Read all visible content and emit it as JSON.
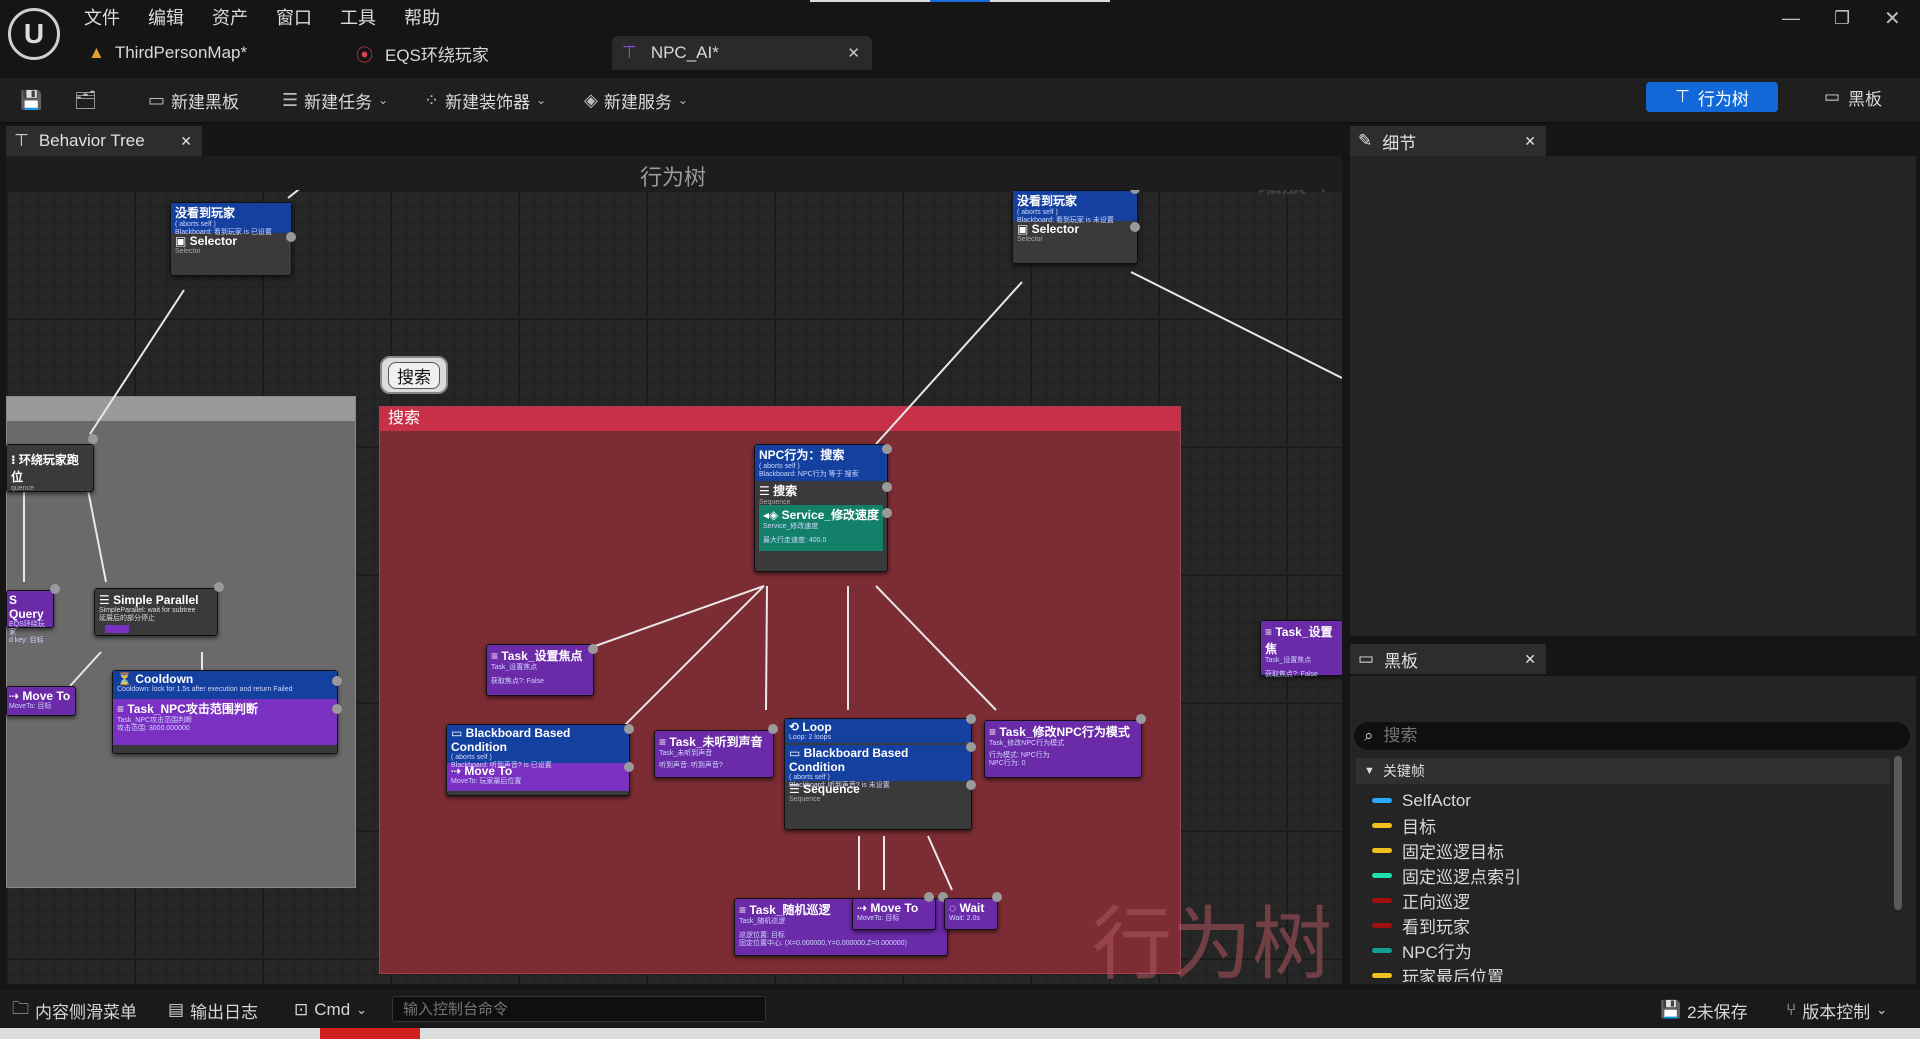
{
  "menu": {
    "items": [
      "文件",
      "编辑",
      "资产",
      "窗口",
      "工具",
      "帮助"
    ],
    "logo": "U"
  },
  "tabs": [
    {
      "label": "ThirdPersonMap*",
      "icon": "map-icon"
    },
    {
      "label": "EQS环绕玩家",
      "icon": "eqs-pin-icon"
    },
    {
      "label": "NPC_AI*",
      "icon": "behavior-tree-icon"
    }
  ],
  "toolbar": {
    "new_blackboard": "新建黑板",
    "new_task": "新建任务",
    "new_decorator": "新建装饰器",
    "new_service": "新建服务",
    "mode_behavior_tree": "行为树",
    "mode_blackboard": "黑板"
  },
  "graph": {
    "tab_label": "Behavior Tree",
    "header_title": "行为树",
    "zoom_label": "缩放-4",
    "watermark": "行为树",
    "comment_bubble": "搜索",
    "comment_title": "搜索"
  },
  "nodes": {
    "n1": {
      "decorator": "没看到玩家",
      "dec_sub1": "( aborts self )",
      "dec_sub2": "Blackboard: 看到玩家 is 已设置",
      "title": "Selector",
      "sub": "Selector"
    },
    "n2": {
      "decorator": "没看到玩家",
      "dec_sub1": "( aborts self )",
      "dec_sub2": "Blackboard: 看到玩家 is 未设置",
      "title": "Selector",
      "sub": "Selector"
    },
    "n3": {
      "title": "环绕玩家跑位",
      "sub": "quence"
    },
    "n4": {
      "title": "S Query",
      "sub1": "EQS环绕玩家",
      "sub2": "d key: 目标"
    },
    "n5": {
      "title": "Simple Parallel",
      "sub1": "SimpleParallel: wait for subtree",
      "sub2": "延展后的部分停止"
    },
    "n6": {
      "title": "Move To",
      "sub": "MoveTo: 目标"
    },
    "n7": {
      "decorator": "Cooldown",
      "dec_sub": "Cooldown: lock for 1.5s after execution and return Failed",
      "title": "Task_NPC攻击范围判断",
      "sub1": "Task_NPC攻击范围判断",
      "sub2": "攻击范围: 3000.000000"
    },
    "n8": {
      "decorator": "NPC行为：搜索",
      "dec_sub1": "( aborts self )",
      "dec_sub2": "Blackboard: NPC行为 等于 搜索",
      "title": "搜索",
      "sub": "Sequence",
      "service": "Service_修改速度",
      "service_sub1": "Service_修改速度",
      "service_sub2": "最大行走速度: 400.0"
    },
    "n9": {
      "title": "Task_设置焦点",
      "sub1": "Task_设置焦点",
      "sub2": "获取焦点?: False"
    },
    "n10": {
      "decorator": "Blackboard Based Condition",
      "dec_sub1": "( aborts self )",
      "dec_sub2": "Blackboard: 听到声音? is 已设置",
      "title": "Move To",
      "sub": "MoveTo: 玩家最后位置"
    },
    "n11": {
      "title": "Task_未听到声音",
      "sub1": "Task_未听到声音",
      "sub2": "听到声音: 听到声音?"
    },
    "n12": {
      "decorator": "Loop",
      "dec_sub": "Loop: 2 loops",
      "decorator2": "Blackboard Based Condition",
      "dec2_sub1": "( aborts self )",
      "dec2_sub2": "Blackboard: 听到声音? is 未设置",
      "title": "Sequence",
      "sub": "Sequence"
    },
    "n13": {
      "title": "Task_修改NPC行为模式",
      "sub1": "Task_修改NPC行为模式",
      "sub2": "行为模式: NPC行为",
      "sub3": "NPC行为: 0"
    },
    "n14": {
      "title": "Task_随机巡逻",
      "sub1": "Task_随机巡逻",
      "sub2": "巡逻位置: 目标",
      "sub3": "固定位置中心: (X=0.000000,Y=0.000000,Z=0.000000)"
    },
    "n15": {
      "title": "Move To",
      "sub": "MoveTo: 目标"
    },
    "n16": {
      "title": "Wait",
      "sub": "Wait: 2.0s"
    },
    "n17": {
      "title": "Task_设置焦",
      "sub1": "Task_设置焦点",
      "sub2": "获取焦点?: False"
    }
  },
  "details": {
    "tab_label": "细节"
  },
  "blackboard": {
    "tab_label": "黑板",
    "search_placeholder": "搜索",
    "category": "关键帧",
    "keys": [
      {
        "name": "SelfActor",
        "color": "#2aa8ff"
      },
      {
        "name": "目标",
        "color": "#f0c020"
      },
      {
        "name": "固定巡逻目标",
        "color": "#f0c020"
      },
      {
        "name": "固定巡逻点索引",
        "color": "#20e0b0"
      },
      {
        "name": "正向巡逻",
        "color": "#a01010"
      },
      {
        "name": "看到玩家",
        "color": "#a01010"
      },
      {
        "name": "NPC行为",
        "color": "#12a090"
      },
      {
        "name": "玩家最后位置",
        "color": "#f0c020"
      }
    ]
  },
  "status": {
    "content_drawer": "内容侧滑菜单",
    "output_log": "输出日志",
    "cmd": "Cmd",
    "console_placeholder": "输入控制台命令",
    "unsaved": "2未保存",
    "source_control": "版本控制"
  }
}
